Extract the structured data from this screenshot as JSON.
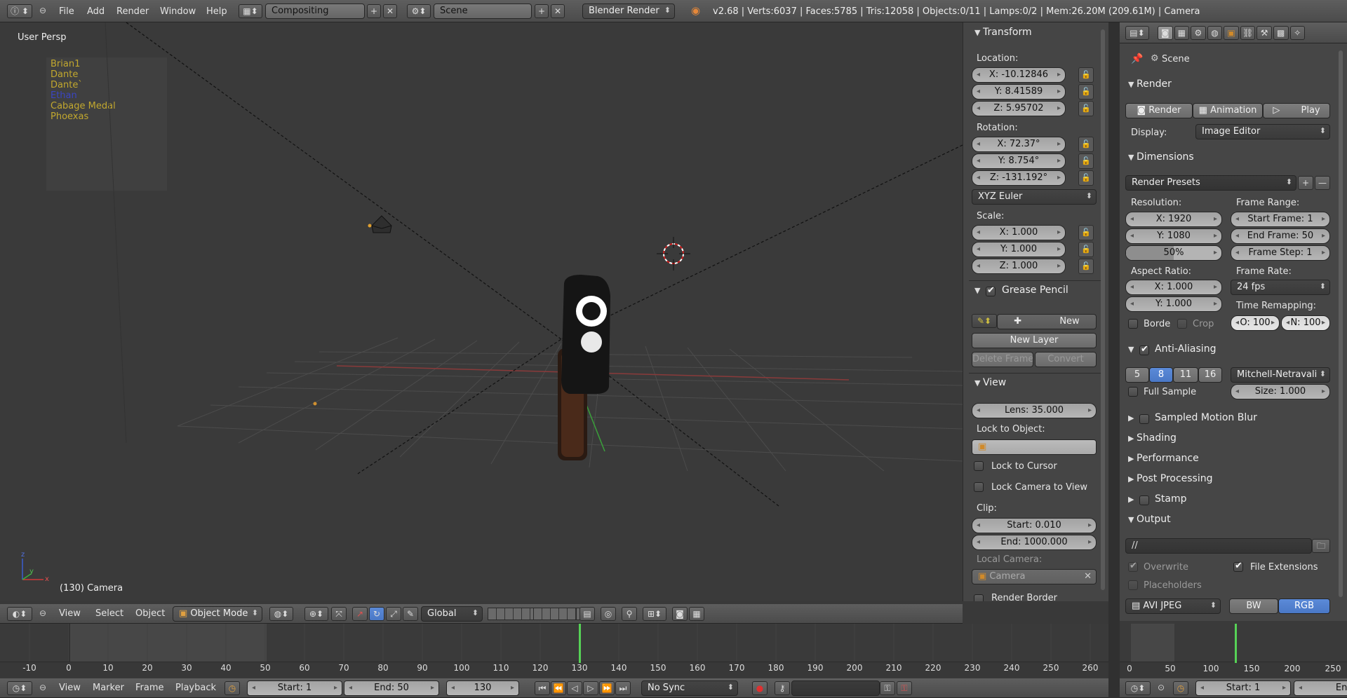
{
  "topbar": {
    "menus": [
      "File",
      "Add",
      "Render",
      "Window",
      "Help"
    ],
    "layout": "Compositing",
    "scene": "Scene",
    "engine": "Blender Render",
    "stats": "v2.68 | Verts:6037 | Faces:5785 | Tris:12058 | Objects:0/11 | Lamps:0/2 | Mem:26.20M (209.61M) | Camera"
  },
  "viewport": {
    "persp": "User Persp",
    "objects": [
      {
        "name": "Brian1",
        "color": "#c2a82e"
      },
      {
        "name": "Dante",
        "color": "#c2a82e"
      },
      {
        "name": "Dante`",
        "color": "#c2a82e"
      },
      {
        "name": "Ethan",
        "color": "#3a45c2"
      },
      {
        "name": "Cabage Medal",
        "color": "#c2a82e"
      },
      {
        "name": "Phoexas",
        "color": "#c2a82e"
      }
    ],
    "frame_label": "(130) Camera",
    "header": {
      "menus": [
        "View",
        "Select",
        "Object"
      ],
      "mode": "Object Mode",
      "orientation": "Global"
    }
  },
  "npanel": {
    "transform": "Transform",
    "location_label": "Location:",
    "location": [
      "X: -10.12846",
      "Y: 8.41589",
      "Z: 5.95702"
    ],
    "rotation_label": "Rotation:",
    "rotation": [
      "X: 72.37°",
      "Y: 8.754°",
      "Z: -131.192°"
    ],
    "rotation_mode": "XYZ Euler",
    "scale_label": "Scale:",
    "scale": [
      "X: 1.000",
      "Y: 1.000",
      "Z: 1.000"
    ],
    "grease_pencil": "Grease Pencil",
    "new": "New",
    "new_layer": "New Layer",
    "delete_frame": "Delete Frame",
    "convert": "Convert",
    "view": "View",
    "lens": "Lens: 35.000",
    "lock_to_object": "Lock to Object:",
    "lock_to_cursor": "Lock to Cursor",
    "lock_camera": "Lock Camera to View",
    "clip": "Clip:",
    "clip_start": "Start: 0.010",
    "clip_end": "End: 1000.000",
    "local_camera": "Local Camera:",
    "camera": "Camera",
    "render_border": "Render Border"
  },
  "properties": {
    "scene": "Scene",
    "render_section": "Render",
    "render_btn": "Render",
    "animation_btn": "Animation",
    "play_btn": "Play",
    "display_label": "Display:",
    "display_value": "Image Editor",
    "dimensions": "Dimensions",
    "presets": "Render Presets",
    "resolution_label": "Resolution:",
    "res_x": "X: 1920",
    "res_y": "Y: 1080",
    "res_pct": "50%",
    "res_pct_fill": 0.5,
    "frame_range_label": "Frame Range:",
    "start_frame": "Start Frame: 1",
    "end_frame": "End Frame: 50",
    "frame_step": "Frame Step: 1",
    "aspect_label": "Aspect Ratio:",
    "aspect_x": "X: 1.000",
    "aspect_y": "Y: 1.000",
    "frame_rate_label": "Frame Rate:",
    "frame_rate": "24 fps",
    "border": "Borde",
    "crop": "Crop",
    "time_remap_label": "Time Remapping:",
    "remap_old": "·O: 100·",
    "remap_new": "·N: 100·",
    "anti_aliasing": "Anti-Aliasing",
    "aa_samples": [
      "5",
      "8",
      "11",
      "16"
    ],
    "aa_active": "8",
    "aa_filter": "Mitchell-Netravali",
    "full_sample": "Full Sample",
    "aa_size": "Size: 1.000",
    "collapsed": [
      "Sampled Motion Blur",
      "Shading",
      "Performance",
      "Post Processing",
      "Stamp"
    ],
    "output": "Output",
    "output_path": "//",
    "overwrite": "Overwrite",
    "file_extensions": "File Extensions",
    "placeholders": "Placeholders",
    "format": "AVI JPEG",
    "bw": "BW",
    "rgb": "RGB"
  },
  "timeline": {
    "ticks": [
      -10,
      0,
      10,
      20,
      30,
      40,
      50,
      60,
      70,
      80,
      90,
      100,
      110,
      120,
      130,
      140,
      150,
      160,
      170,
      180,
      190,
      200,
      210,
      220,
      230,
      240,
      250,
      260
    ],
    "current_frame": 130,
    "header": {
      "menus": [
        "View",
        "Marker",
        "Frame",
        "Playback"
      ],
      "start": "Start: 1",
      "end": "End: 50",
      "frame": "130",
      "sync": "No Sync"
    }
  },
  "timeline2": {
    "ticks": [
      0,
      50,
      100,
      150,
      200,
      250
    ],
    "current_frame": 130,
    "start": "Start: 1",
    "end": "End:"
  },
  "colors": {
    "accent": "#5680c2",
    "playhead": "#56d256",
    "object": "#c2a82e"
  }
}
